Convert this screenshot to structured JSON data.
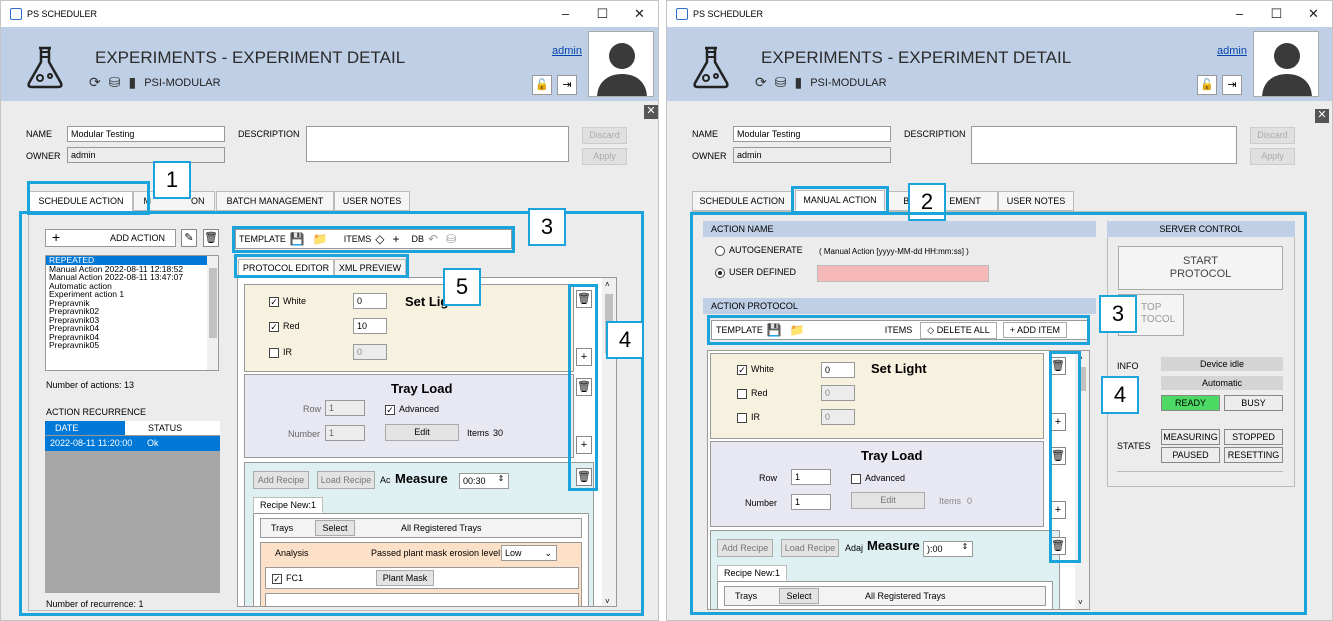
{
  "app_title": "PS SCHEDULER",
  "window_controls": {
    "minimize": "–",
    "maximize": "☐",
    "close": "✕"
  },
  "header": {
    "title": "EXPERIMENTS - EXPERIMENT DETAIL",
    "device": "PSI-MODULAR",
    "user": "admin"
  },
  "form": {
    "name_label": "NAME",
    "name_value": "Modular Testing",
    "owner_label": "OWNER",
    "owner_value": "admin",
    "description_label": "DESCRIPTION",
    "discard": "Discard",
    "apply": "Apply"
  },
  "tabs": {
    "schedule": "SCHEDULE ACTION",
    "manual": "MANUAL ACTION",
    "batch": "BATCH MANAGEMENT",
    "notes": "USER NOTES",
    "manual_partial_left": "M",
    "manual_partial_right": "ON",
    "batch_partial_left": "BA",
    "batch_partial_right": "EMENT"
  },
  "callouts": {
    "c1": "1",
    "c2": "2",
    "c3": "3",
    "c4": "4",
    "c5": "5"
  },
  "left": {
    "add_action": "ADD ACTION",
    "actions": [
      "REPEATED",
      "Manual Action 2022-08-11  12:18:52",
      "Manual Action 2022-08-11  13:47:07",
      "Automatic action",
      "Experiment action 1",
      "Prepravnik",
      "Prepravnik02",
      "Prepravnik03",
      "Prepravnik04",
      "Prepravnik04",
      "Prepravnik05"
    ],
    "actions_count": "Number of actions: 13",
    "recurrence_title": "ACTION RECURRENCE",
    "rec_date": "DATE",
    "rec_status": "STATUS",
    "rec_row_date": "2022-08-11  11:20:00",
    "rec_row_status": "Ok",
    "rec_count": "Number of recurrence: 1",
    "toolbar": {
      "template": "TEMPLATE",
      "items": "ITEMS",
      "db": "DB"
    },
    "subtabs": {
      "editor": "PROTOCOL EDITOR",
      "xml": "XML PREVIEW"
    },
    "light": {
      "title": "Set Light",
      "white": "White",
      "white_val": "0",
      "red": "Red",
      "red_val": "10",
      "ir": "IR",
      "ir_val": "0"
    },
    "tray": {
      "title": "Tray Load",
      "row": "Row",
      "row_val": "1",
      "advanced": "Advanced",
      "number": "Number",
      "number_val": "1",
      "edit": "Edit",
      "items": "Items",
      "items_val": "30"
    },
    "measure": {
      "add": "Add Recipe",
      "load": "Load Recipe",
      "ac": "Ac",
      "title": "Measure",
      "time": "00:30",
      "recipe": "Recipe New:1",
      "trays": "Trays",
      "select": "Select",
      "all": "All Registered Trays",
      "analysis": "Analysis",
      "erosion": "Passed plant mask erosion level:",
      "low": "Low",
      "fc1": "FC1",
      "mask": "Plant Mask"
    }
  },
  "right": {
    "action_name": "ACTION NAME",
    "autogenerate": "AUTOGENERATE",
    "auto_format": "( Manual Action [yyyy-MM-dd  HH:mm:ss] )",
    "user_defined": "USER DEFINED",
    "action_protocol": "ACTION PROTOCOL",
    "toolbar": {
      "template": "TEMPLATE",
      "items": "ITEMS",
      "delete_all": "DELETE ALL",
      "add_item": "ADD ITEM"
    },
    "light": {
      "title": "Set Light",
      "white": "White",
      "white_val": "0",
      "red": "Red",
      "red_val": "0",
      "ir": "IR",
      "ir_val": "0"
    },
    "tray": {
      "title": "Tray Load",
      "row": "Row",
      "row_val": "1",
      "advanced": "Advanced",
      "number": "Number",
      "number_val": "1",
      "edit": "Edit",
      "items": "Items",
      "items_val": "0"
    },
    "measure": {
      "add": "Add Recipe",
      "load": "Load Recipe",
      "ada": "Adaj",
      "title": "Measure",
      "time": "):00",
      "recipe": "Recipe New:1",
      "trays": "Trays",
      "select": "Select",
      "all": "All Registered Trays"
    },
    "server": {
      "title": "SERVER CONTROL",
      "start_1": "START",
      "start_2": "PROTOCOL",
      "stop_1": "TOP",
      "stop_2": "TOCOL",
      "info": "INFO",
      "device_idle": "Device idle",
      "automatic": "Automatic",
      "ready": "READY",
      "busy": "BUSY",
      "states": "STATES",
      "measuring": "MEASURING",
      "stopped": "STOPPED",
      "paused": "PAUSED",
      "resetting": "RESETTING"
    }
  },
  "colors": {
    "accent": "#1ba4dc",
    "header": "#bfcfe6",
    "ready": "#4cd964",
    "select": "#0078d7"
  }
}
